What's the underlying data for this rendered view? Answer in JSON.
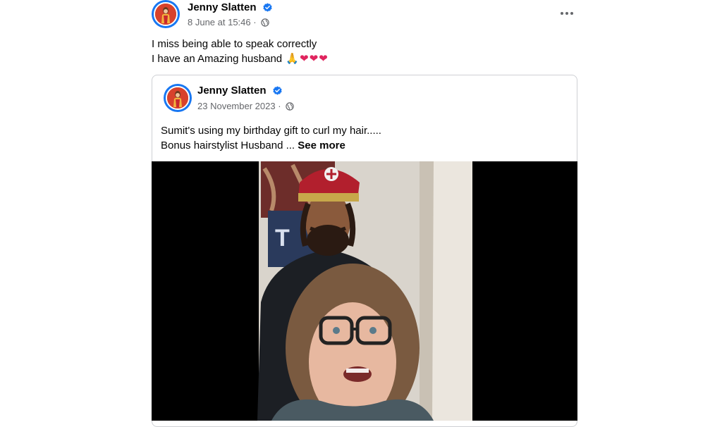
{
  "post": {
    "author_name": "Jenny Slatten",
    "timestamp": "8 June at 15:46",
    "separator": "·",
    "privacy_icon": "globe-icon",
    "more_icon": "more-options-icon",
    "text_line1": "I miss being able to speak correctly",
    "text_line2": "I have an Amazing husband",
    "emojis": [
      "🙏",
      "❤",
      "❤",
      "❤"
    ]
  },
  "shared_post": {
    "author_name": "Jenny Slatten",
    "timestamp": "23 November 2023",
    "separator": "·",
    "privacy_icon": "globe-icon",
    "text_line1": "Sumit's using my birthday  gift to curl my hair.....",
    "text_line2": "Bonus hairstylist Husband ...",
    "see_more_label": "See more",
    "video_icon": "video-thumbnail"
  },
  "colors": {
    "verified_badge": "#1877f2",
    "meta_text": "#65676b",
    "heart": "#e0245e"
  }
}
